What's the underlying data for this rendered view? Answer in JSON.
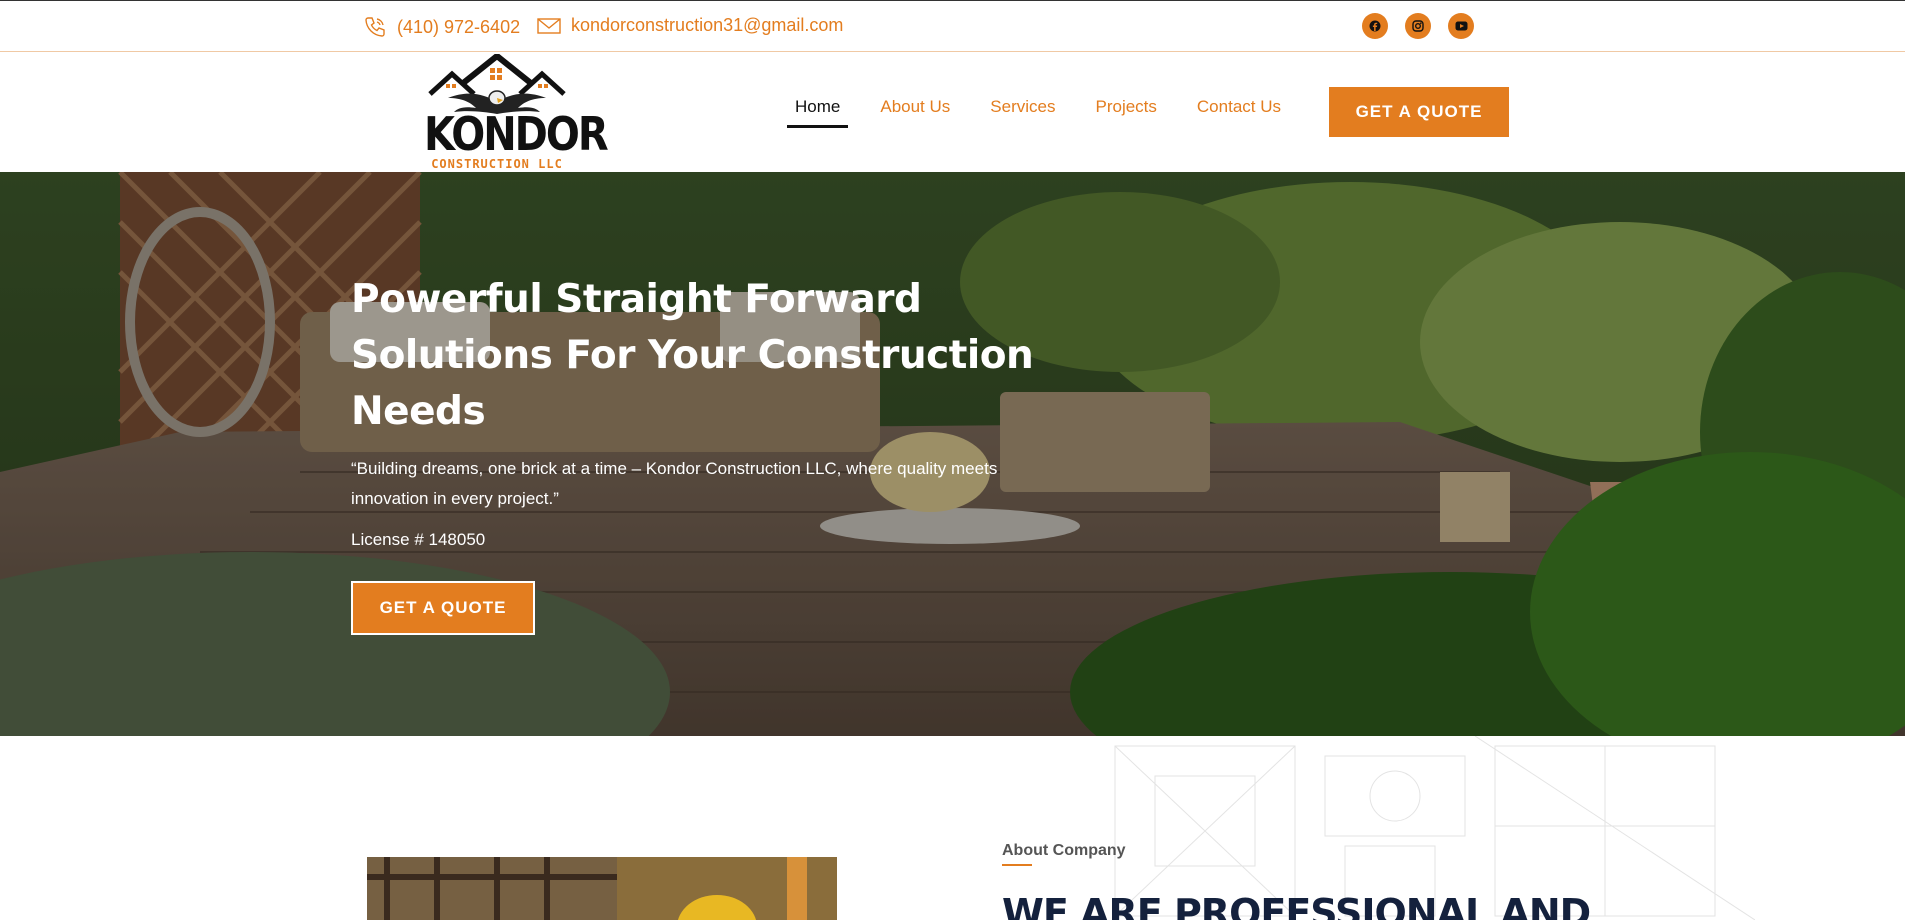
{
  "topbar": {
    "phone": "(410) 972-6402",
    "email": "kondorconstruction31@gmail.com",
    "socials": [
      "facebook-icon",
      "instagram-icon",
      "youtube-icon"
    ]
  },
  "brand": {
    "name": "KONDOR",
    "subtitle": "CONSTRUCTION LLC",
    "accent_color": "#e37d1f"
  },
  "nav": {
    "items": [
      {
        "label": "Home",
        "active": true
      },
      {
        "label": "About Us",
        "active": false
      },
      {
        "label": "Services",
        "active": false
      },
      {
        "label": "Projects",
        "active": false
      },
      {
        "label": "Contact Us",
        "active": false
      }
    ],
    "cta": "GET A QUOTE"
  },
  "hero": {
    "title_line1": "Powerful Straight Forward",
    "title_line2": "Solutions For Your Construction",
    "title_line3": "Needs",
    "quote": "“Building dreams, one brick at a time – Kondor Construction LLC, where quality meets innovation in every project.”",
    "license": "License # 148050",
    "cta": "GET A QUOTE"
  },
  "about": {
    "label": "About Company",
    "heading": "WE ARE PROFESSIONAL AND"
  }
}
